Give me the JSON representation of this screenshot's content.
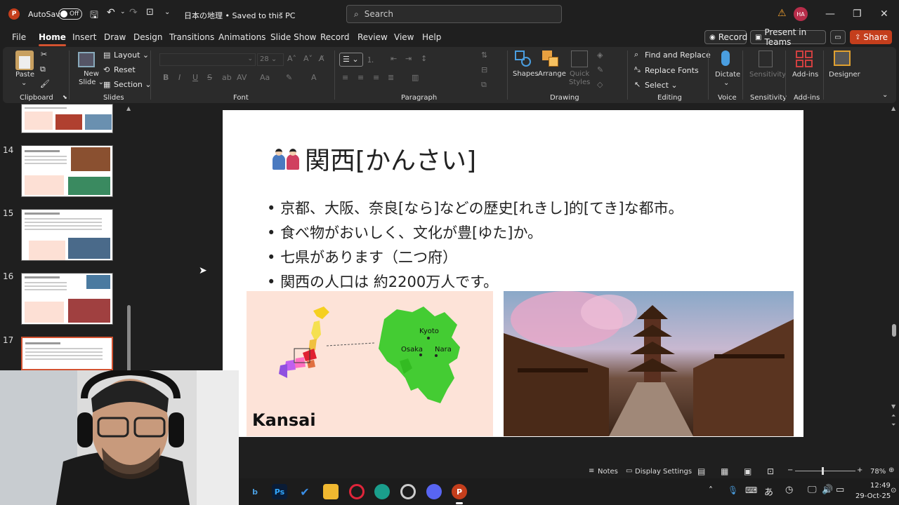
{
  "titlebar": {
    "autosave_label": "AutoSave",
    "autosave_state": "Off",
    "doc_title": "日本の地理 • Saved to this PC",
    "search_placeholder": "Search",
    "user_initials": "HA"
  },
  "menu": [
    "File",
    "Home",
    "Insert",
    "Draw",
    "Design",
    "Transitions",
    "Animations",
    "Slide Show",
    "Record",
    "Review",
    "View",
    "Help"
  ],
  "right_buttons": {
    "record": "Record",
    "present": "Present in Teams",
    "share": "Share"
  },
  "ribbon": {
    "clipboard": {
      "paste": "Paste",
      "group": "Clipboard"
    },
    "slides": {
      "new_slide": "New\nSlide",
      "layout": "Layout",
      "reset": "Reset",
      "section": "Section",
      "group": "Slides"
    },
    "font": {
      "size": "28",
      "group": "Font"
    },
    "paragraph": {
      "group": "Paragraph"
    },
    "drawing": {
      "shapes": "Shapes",
      "arrange": "Arrange",
      "quick_styles": "Quick\nStyles",
      "group": "Drawing"
    },
    "editing": {
      "find_replace": "Find and Replace",
      "replace_fonts": "Replace Fonts",
      "select": "Select",
      "group": "Editing"
    },
    "voice": {
      "dictate": "Dictate",
      "group": "Voice"
    },
    "sensitivity": {
      "label": "Sensitivity",
      "group": "Sensitivity"
    },
    "addins": {
      "label": "Add-ins",
      "group": "Add-ins"
    },
    "designer": {
      "label": "Designer"
    }
  },
  "thumbnails": [
    {
      "num": "14"
    },
    {
      "num": "15"
    },
    {
      "num": "16"
    },
    {
      "num": "17"
    }
  ],
  "slide": {
    "title": "関西[かんさい]",
    "bullets": [
      "京都、大阪、奈良[なら]などの歴史[れきし]的[てき]な都市。",
      "食べ物がおいしく、文化が豊[ゆた]か。",
      "七県があります（二つ府）",
      "関西の人口は 約2200万人です。"
    ],
    "map_label": "Kansai",
    "cities": [
      "Kyoto",
      "Osaka",
      "Nara"
    ]
  },
  "status": {
    "notes": "Notes",
    "display": "Display Settings",
    "zoom": "78%"
  },
  "clock": {
    "time": "12:49",
    "date": "29-Oct-25"
  },
  "colors": {
    "accent": "#d35230",
    "ribbon": "#2b2b2b",
    "bg": "#1f1f1f"
  }
}
